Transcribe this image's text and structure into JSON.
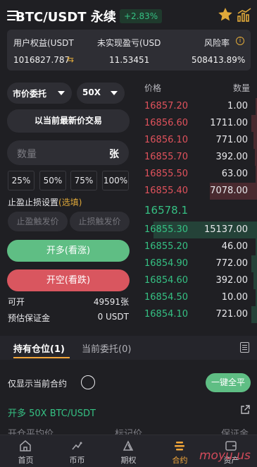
{
  "header": {
    "title": "BTC/USDT 永续",
    "change_badge": "+2.83%",
    "icons": [
      "menu-icon",
      "star-icon",
      "kline-chart-icon"
    ]
  },
  "account": {
    "equity_label": "用户权益(USDT",
    "equity_value": "1016827.787",
    "unrealized_label": "未实现盈亏(USD",
    "unrealized_value": "11.53451",
    "risk_label": "风险率",
    "risk_value": "508413.89%",
    "swap_glyph": "⇆",
    "info_glyph": "i"
  },
  "order_form": {
    "order_type": "市价委托",
    "leverage": "50X",
    "market_button": "以当前最新价交易",
    "qty_placeholder": "数量",
    "qty_unit": "张",
    "percents": [
      "25%",
      "50%",
      "75%",
      "100%"
    ],
    "tp_sl_label": "止盈止损设置",
    "tp_sl_optional": "(选填)",
    "tp_placeholder": "止盈触发价",
    "sl_placeholder": "止损触发价",
    "open_long": "开多(看涨)",
    "open_short": "开空(看跌)",
    "available_label": "可开",
    "available_value": "49591张",
    "margin_label": "预估保证金",
    "margin_value": "0 USDT"
  },
  "order_book": {
    "price_header": "价格",
    "qty_header": "数量",
    "asks": [
      {
        "price": "16857.20",
        "qty": "1.00",
        "depth": 0.01
      },
      {
        "price": "16856.60",
        "qty": "1711.00",
        "depth": 0.05
      },
      {
        "price": "16856.10",
        "qty": "771.00",
        "depth": 0.03
      },
      {
        "price": "16855.70",
        "qty": "392.00",
        "depth": 0.02
      },
      {
        "price": "16855.50",
        "qty": "63.00",
        "depth": 0.01
      },
      {
        "price": "16855.40",
        "qty": "7078.00",
        "depth": 0.42
      }
    ],
    "last_price": "16578.1",
    "bids": [
      {
        "price": "16855.30",
        "qty": "15137.00",
        "depth": 0.92
      },
      {
        "price": "16855.20",
        "qty": "46.00",
        "depth": 0.01
      },
      {
        "price": "16854.90",
        "qty": "772.00",
        "depth": 0.05
      },
      {
        "price": "16854.60",
        "qty": "392.00",
        "depth": 0.03
      },
      {
        "price": "16854.50",
        "qty": "10.00",
        "depth": 0.01
      },
      {
        "price": "16854.10",
        "qty": "721.00",
        "depth": 0.05
      }
    ],
    "ask_color": "#e0525c",
    "bid_color": "#35c083"
  },
  "positions": {
    "tab_holdings": "持有仓位(1)",
    "tab_orders": "当前委托(0)",
    "only_current_label": "仅显示当前合约",
    "close_all": "一键全平",
    "position_title": "开多 50X BTC/USDT",
    "col_open_avg": "开仓平均价",
    "col_mark": "标记价",
    "col_margin": "保证金"
  },
  "nav": {
    "items": [
      {
        "label": "首页",
        "icon": "home-icon"
      },
      {
        "label": "币币",
        "icon": "spot-icon"
      },
      {
        "label": "期权",
        "icon": "options-icon"
      },
      {
        "label": "合约",
        "icon": "contract-icon"
      },
      {
        "label": "资产",
        "icon": "assets-icon"
      }
    ],
    "active_index": 3
  },
  "watermark": "moyu.us",
  "colors": {
    "background": "#1f1f23",
    "panel": "#2e2e34",
    "green": "#35c083",
    "red": "#e0525c",
    "accent": "#f3a73a"
  }
}
